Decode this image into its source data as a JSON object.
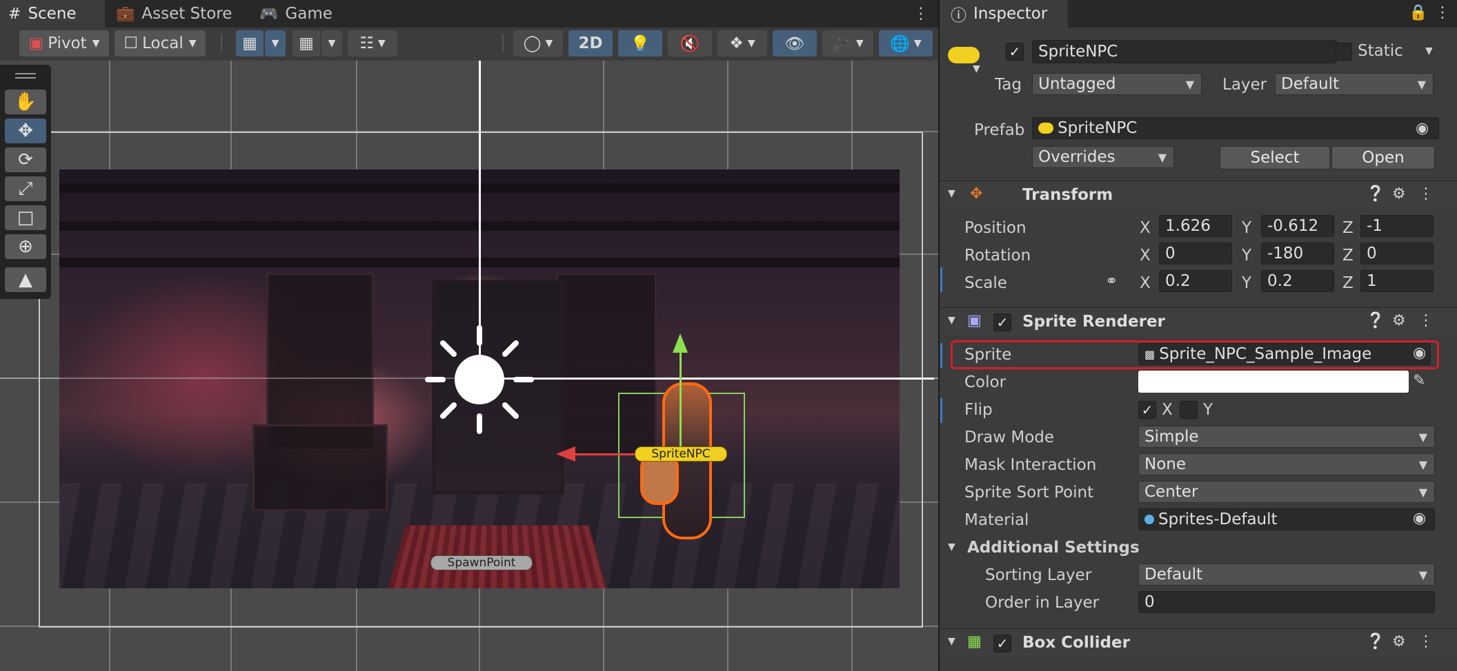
{
  "scene_tabs": [
    {
      "label": "Scene",
      "icon": "grid-icon"
    },
    {
      "label": "Asset Store",
      "icon": "bag-icon"
    },
    {
      "label": "Game",
      "icon": "gamepad-icon"
    }
  ],
  "scene_toolbar": {
    "pivot": "Pivot",
    "local": "Local",
    "mode_2d": "2D"
  },
  "scene_labels": {
    "npc": "SpriteNPC",
    "spawn": "SpawnPoint"
  },
  "inspector": {
    "tab": "Inspector",
    "object_name": "SpriteNPC",
    "static_label": "Static",
    "tag_label": "Tag",
    "tag_value": "Untagged",
    "layer_label": "Layer",
    "layer_value": "Default",
    "prefab_label": "Prefab",
    "prefab_value": "SpriteNPC",
    "overrides": "Overrides",
    "select": "Select",
    "open": "Open"
  },
  "transform": {
    "title": "Transform",
    "rows": [
      {
        "label": "Position",
        "x": "1.626",
        "y": "-0.612",
        "z": "-1"
      },
      {
        "label": "Rotation",
        "x": "0",
        "y": "-180",
        "z": "0"
      },
      {
        "label": "Scale",
        "x": "0.2",
        "y": "0.2",
        "z": "1"
      }
    ],
    "axes": [
      "X",
      "Y",
      "Z"
    ]
  },
  "sprite_renderer": {
    "title": "Sprite Renderer",
    "sprite_label": "Sprite",
    "sprite_value": "Sprite_NPC_Sample_Image",
    "color_label": "Color",
    "color_value": "#ffffff",
    "flip_label": "Flip",
    "flip_x": "X",
    "flip_y": "Y",
    "draw_mode_label": "Draw Mode",
    "draw_mode_value": "Simple",
    "mask_label": "Mask Interaction",
    "mask_value": "None",
    "sort_point_label": "Sprite Sort Point",
    "sort_point_value": "Center",
    "material_label": "Material",
    "material_value": "Sprites-Default",
    "additional": "Additional Settings",
    "sorting_layer_label": "Sorting Layer",
    "sorting_layer_value": "Default",
    "order_label": "Order in Layer",
    "order_value": "0"
  },
  "box_collider": {
    "title": "Box Collider"
  },
  "colors": {
    "accent_blue": "#46607c",
    "highlight_red": "#d0202a",
    "prefab_yellow": "#f0d020"
  }
}
